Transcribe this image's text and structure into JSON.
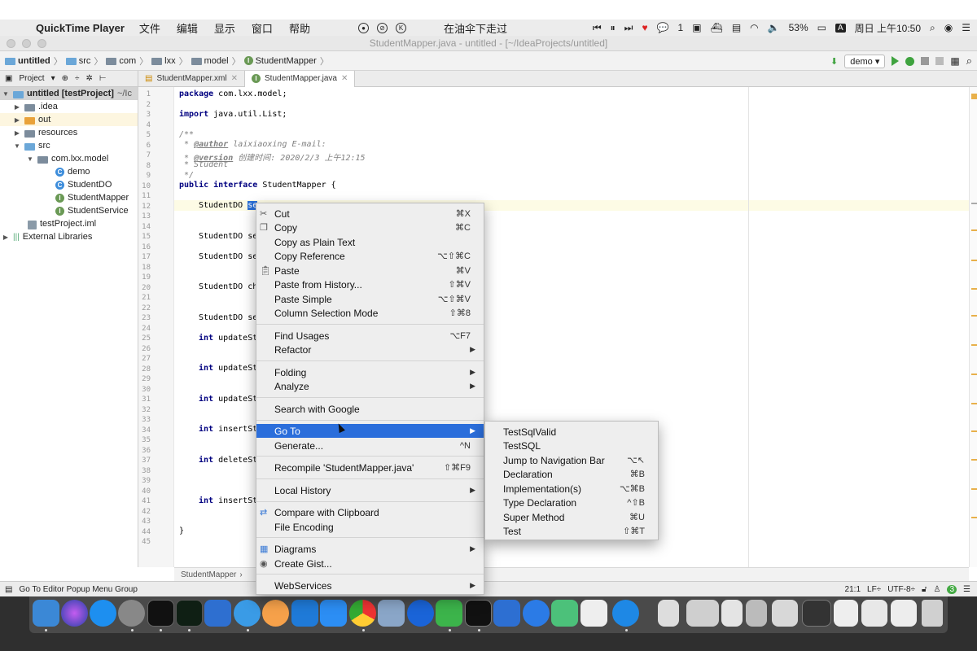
{
  "menubar": {
    "apple": "",
    "app_name": "QuickTime Player",
    "items": [
      "文件",
      "编辑",
      "显示",
      "窗口",
      "帮助"
    ],
    "center_icon_k": "K",
    "center_title": "在油伞下走过",
    "wechat_count": "1",
    "battery": "53%",
    "input_source": "A",
    "datetime": "周日 上午10:50"
  },
  "window": {
    "title": "StudentMapper.java - untitled - [~/IdeaProjects/untitled]"
  },
  "navbar": {
    "crumbs": [
      "untitled",
      "src",
      "com",
      "lxx",
      "model",
      "StudentMapper"
    ],
    "run_config": "demo"
  },
  "tabs": {
    "project_label": "Project",
    "items": [
      {
        "label": "StudentMapper.xml",
        "active": false
      },
      {
        "label": "StudentMapper.java",
        "active": true
      }
    ]
  },
  "project_tree": [
    {
      "label": "untitled [testProject]",
      "suffix": "~/Ic"
    },
    {
      "label": ".idea"
    },
    {
      "label": "out"
    },
    {
      "label": "resources"
    },
    {
      "label": "src"
    },
    {
      "label": "com.lxx.model"
    },
    {
      "label": "demo",
      "badge": "C"
    },
    {
      "label": "StudentDO",
      "badge": "C"
    },
    {
      "label": "StudentMapper",
      "badge": "I"
    },
    {
      "label": "StudentService",
      "badge": "I"
    },
    {
      "label": "testProject.iml"
    },
    {
      "label": "External Libraries"
    }
  ],
  "code": {
    "line_numbers": [
      "1",
      "2",
      "3",
      "4",
      "5",
      "6",
      "7",
      "8",
      "9",
      "10",
      "11",
      "12",
      "13",
      "14",
      "15",
      "16",
      "17",
      "18",
      "19",
      "20",
      "21",
      "22",
      "23",
      "24",
      "25",
      "26",
      "27",
      "28",
      "29",
      "30",
      "31",
      "32",
      "33",
      "34",
      "35",
      "36",
      "37",
      "38",
      "39",
      "40",
      "41",
      "42",
      "43",
      "44",
      "45"
    ],
    "package_kw": "package",
    "package_rest": " com.lxx.model;",
    "import_kw": "import",
    "import_rest": " java.util.List;",
    "doc_open": "/**",
    "author_tag": "@author",
    "author_rest": " laixiaoxing E-mail:",
    "version_tag": "@version",
    "version_rest": " 创建时间: 2020/2/3 上午12:15",
    "doc_desc": " * Student",
    "doc_close": " */",
    "iface_kw": "public interface",
    "iface_rest": " StudentMapper {",
    "l12_type": "StudentDO ",
    "l12_sel": "se",
    "l15": "StudentDO se",
    "l17": "StudentDO se",
    "l20": "StudentDO ch",
    "l23": "StudentDO se",
    "l25_kw": "int",
    "l25": " updateSt",
    "l28_kw": "int",
    "l28": " updateSt",
    "l31_kw": "int",
    "l31": " updateSt",
    "l34_kw": "int",
    "l34": " insertSt",
    "l37_kw": "int",
    "l37": " deleteSt",
    "l41_kw": "int",
    "l41": " insertSt",
    "close": "}"
  },
  "editor_breadcrumb": "StudentMapper",
  "context_menu": [
    {
      "label": "Cut",
      "shortcut": "⌘X",
      "icon": "scissors-icon"
    },
    {
      "label": "Copy",
      "shortcut": "⌘C",
      "icon": "copy-icon"
    },
    {
      "label": "Copy as Plain Text",
      "shortcut": ""
    },
    {
      "label": "Copy Reference",
      "shortcut": "⌥⇧⌘C"
    },
    {
      "label": "Paste",
      "shortcut": "⌘V",
      "icon": "paste-icon"
    },
    {
      "label": "Paste from History...",
      "shortcut": "⇧⌘V"
    },
    {
      "label": "Paste Simple",
      "shortcut": "⌥⇧⌘V"
    },
    {
      "label": "Column Selection Mode",
      "shortcut": "⇧⌘8"
    },
    {
      "label": "Find Usages",
      "shortcut": "⌥F7"
    },
    {
      "label": "Refactor",
      "submenu": true
    },
    {
      "label": "Folding",
      "submenu": true
    },
    {
      "label": "Analyze",
      "submenu": true
    },
    {
      "label": "Search with Google",
      "shortcut": ""
    },
    {
      "label": "Go To",
      "submenu": true,
      "active": true
    },
    {
      "label": "Generate...",
      "shortcut": "^N"
    },
    {
      "label": "Recompile 'StudentMapper.java'",
      "shortcut": "⇧⌘F9"
    },
    {
      "label": "Local History",
      "submenu": true
    },
    {
      "label": "Compare with Clipboard",
      "shortcut": "",
      "icon": "compare-icon"
    },
    {
      "label": "File Encoding",
      "shortcut": ""
    },
    {
      "label": "Diagrams",
      "submenu": true,
      "icon": "diagram-icon"
    },
    {
      "label": "Create Gist...",
      "shortcut": "",
      "icon": "github-icon"
    },
    {
      "label": "WebServices",
      "submenu": true
    }
  ],
  "goto_submenu": [
    {
      "label": "TestSqlValid",
      "shortcut": ""
    },
    {
      "label": "TestSQL",
      "shortcut": ""
    },
    {
      "label": "Jump to Navigation Bar",
      "shortcut": "⌥↖"
    },
    {
      "label": "Declaration",
      "shortcut": "⌘B"
    },
    {
      "label": "Implementation(s)",
      "shortcut": "⌥⌘B"
    },
    {
      "label": "Type Declaration",
      "shortcut": "^⇧B"
    },
    {
      "label": "Super Method",
      "shortcut": "⌘U"
    },
    {
      "label": "Test",
      "shortcut": "⇧⌘T"
    }
  ],
  "statusbar": {
    "message": "Go To Editor Popup Menu Group",
    "position": "21:1",
    "line_sep": "LF÷",
    "encoding": "UTF-8÷"
  },
  "colors": {
    "menu_highlight": "#2b6edb",
    "selection": "#2a6fd6",
    "keyword": "#000080"
  }
}
